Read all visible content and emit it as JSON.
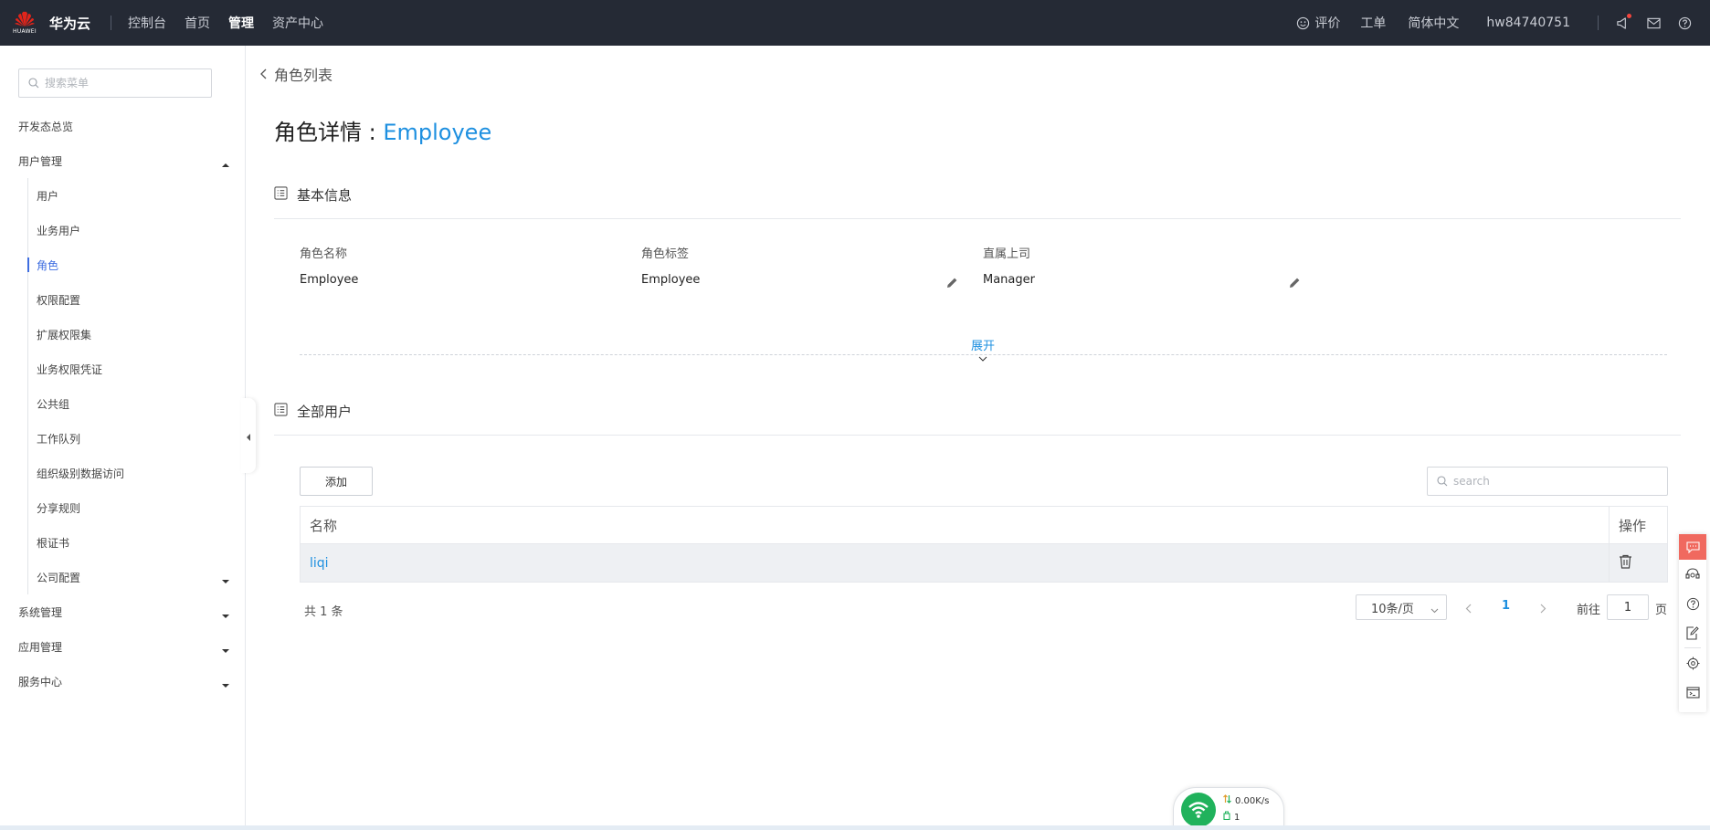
{
  "topbar": {
    "logo_small": "HUAWEI",
    "brand": "华为云",
    "nav": [
      "控制台",
      "首页",
      "管理",
      "资产中心"
    ],
    "nav_active_index": 2,
    "feedback": "评价",
    "ticket": "工单",
    "language": "简体中文",
    "username": "hw84740751"
  },
  "sidebar": {
    "search_placeholder": "搜索菜单",
    "items": [
      {
        "label": "开发态总览"
      },
      {
        "label": "用户管理"
      },
      {
        "label": "用户"
      },
      {
        "label": "业务用户"
      },
      {
        "label": "角色"
      },
      {
        "label": "权限配置"
      },
      {
        "label": "扩展权限集"
      },
      {
        "label": "业务权限凭证"
      },
      {
        "label": "公共组"
      },
      {
        "label": "工作队列"
      },
      {
        "label": "组织级别数据访问"
      },
      {
        "label": "分享规则"
      },
      {
        "label": "根证书"
      },
      {
        "label": "公司配置"
      },
      {
        "label": "系统管理"
      },
      {
        "label": "应用管理"
      },
      {
        "label": "服务中心"
      }
    ]
  },
  "main": {
    "back_label": "角色列表",
    "title_prefix": "角色详情 : ",
    "title_role": "Employee",
    "basic": {
      "heading": "基本信息",
      "fields": [
        {
          "label": "角色名称",
          "value": "Employee"
        },
        {
          "label": "角色标签",
          "value": "Employee"
        },
        {
          "label": "直属上司",
          "value": "Manager"
        }
      ],
      "expand_label": "展开"
    },
    "users": {
      "heading": "全部用户",
      "add_label": "添加",
      "search_placeholder": "search",
      "columns": [
        "名称",
        "操作"
      ],
      "rows": [
        {
          "name": "liqi"
        }
      ],
      "total": "共 1 条",
      "page_size": "10条/页",
      "current_page": "1",
      "goto_label": "前往",
      "goto_value": "1",
      "goto_unit": "页"
    }
  },
  "network": {
    "speed": "0.00K/s",
    "count": "1"
  },
  "colors": {
    "topbar_bg": "#252a35",
    "accent_blue": "#1e90e0",
    "menu_selected": "#3e6de0",
    "float_red": "#f0695f",
    "wifi_green": "#20b25c"
  }
}
